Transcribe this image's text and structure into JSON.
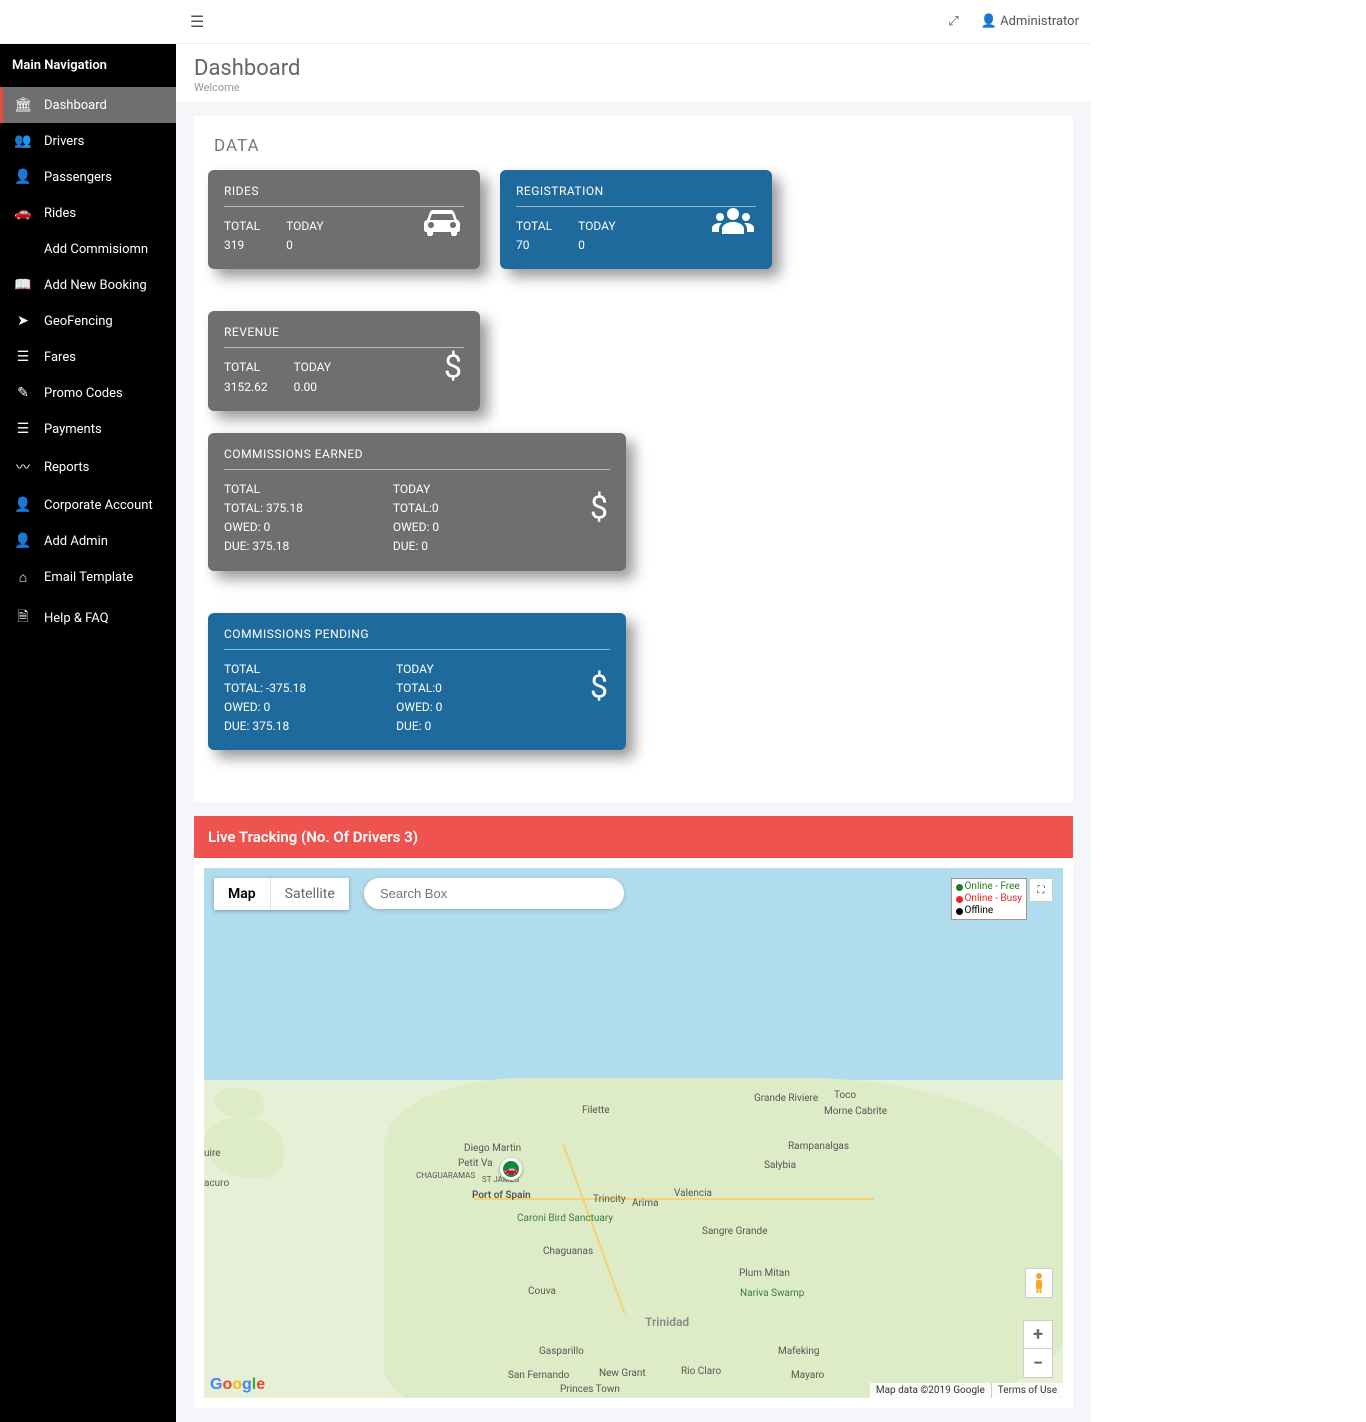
{
  "top": {
    "user": "Administrator"
  },
  "sidebar": {
    "heading": "Main Navigation",
    "items": [
      {
        "label": "Dashboard"
      },
      {
        "label": "Drivers"
      },
      {
        "label": "Passengers"
      },
      {
        "label": "Rides"
      },
      {
        "label": "Add Commisiomn"
      },
      {
        "label": "Add New Booking"
      },
      {
        "label": "GeoFencing"
      },
      {
        "label": "Fares"
      },
      {
        "label": "Promo Codes"
      },
      {
        "label": "Payments"
      },
      {
        "label": "Reports"
      },
      {
        "label": "Corporate Account"
      },
      {
        "label": "Add Admin"
      },
      {
        "label": "Email Template"
      },
      {
        "label": "Help & FAQ"
      }
    ]
  },
  "page": {
    "title": "Dashboard",
    "subtitle": "Welcome"
  },
  "data_label": "DATA",
  "cards": {
    "rides": {
      "title": "RIDES",
      "total": "319",
      "today": "0",
      "h1": "TOTAL",
      "h2": "TODAY"
    },
    "registration": {
      "title": "REGISTRATION",
      "total": "70",
      "today": "0",
      "h1": "TOTAL",
      "h2": "TODAY"
    },
    "revenue": {
      "title": "REVENUE",
      "total": "3152.62",
      "today": "0.00",
      "h1": "TOTAL",
      "h2": "TODAY"
    },
    "comm_earned": {
      "title": "COMMISSIONS EARNED",
      "col1": {
        "l1": "TOTAL",
        "l2": "TOTAL: 375.18",
        "l3": "OWED: 0",
        "l4": "DUE: 375.18"
      },
      "col2": {
        "l1": "TODAY",
        "l2": "TOTAL:0",
        "l3": "OWED: 0",
        "l4": "DUE: 0"
      }
    },
    "comm_pending": {
      "title": "COMMISSIONS PENDING",
      "col1": {
        "l1": "TOTAL",
        "l2": "TOTAL: -375.18",
        "l3": "OWED: 0",
        "l4": "DUE: 375.18"
      },
      "col2": {
        "l1": "TODAY",
        "l2": "TOTAL:0",
        "l3": "OWED: 0",
        "l4": "DUE: 0"
      }
    }
  },
  "tracking": {
    "header": "Live Tracking (No. Of Drivers 3)"
  },
  "map": {
    "tab_map": "Map",
    "tab_sat": "Satellite",
    "search_placeholder": "Search Box",
    "legend": {
      "free": "Online - Free",
      "busy": "Online - Busy",
      "off": "Offline"
    },
    "attrib": "Map data ©2019 Google",
    "terms": "Terms of Use",
    "labels": {
      "pos": "Port of Spain",
      "trincity": "Trincity",
      "arima": "Arima",
      "valencia": "Valencia",
      "sangre": "Sangre Grande",
      "toco": "Toco",
      "grande_riviere": "Grande Riviere",
      "morne": "Morne Cabrite",
      "rampa": "Rampanalgas",
      "salybia": "Salybia",
      "diego": "Diego Martin",
      "petit": "Petit Va",
      "stjames": "ST JAMES",
      "chagua": "CHAGUARAMAS",
      "filette": "Filette",
      "caroni": "Caroni Bird Sanctuary",
      "chaguanas": "Chaguanas",
      "couva": "Couva",
      "trinidad": "Trinidad",
      "nariva": "Nariva Swamp",
      "plum": "Plum Mitan",
      "mafeking": "Mafeking",
      "mayaro": "Mayaro",
      "rioclaro": "Rio Claro",
      "newgrant": "New Grant",
      "gasparillo": "Gasparillo",
      "sanfernando": "San Fernando",
      "princes": "Princes Town",
      "acuro": "acuro",
      "uire": "uire"
    }
  }
}
